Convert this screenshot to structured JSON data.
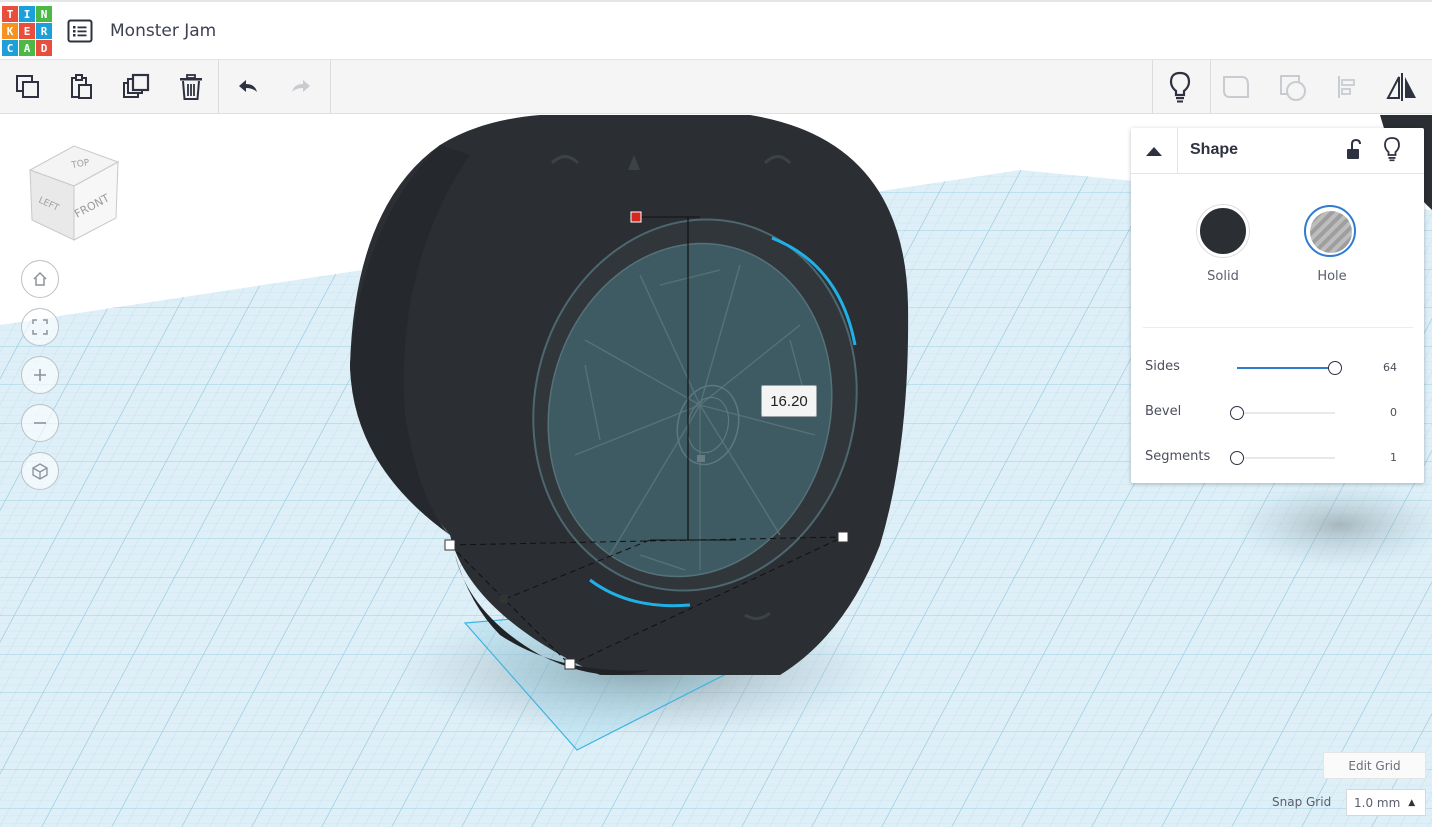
{
  "app": {
    "logo_letters": [
      [
        "T",
        "I",
        "N"
      ],
      [
        "K",
        "E",
        "R"
      ],
      [
        "C",
        "A",
        "D"
      ]
    ],
    "logo_colors": [
      "#e94e3d",
      "#1d9fd9",
      "#4cb848",
      "#f7921e"
    ],
    "document_title": "Monster Jam"
  },
  "toolbar": {
    "left_tools": [
      "copy-icon",
      "paste-icon",
      "duplicate-icon",
      "delete-icon",
      "undo-icon",
      "redo-icon"
    ],
    "right_tools": [
      "lightbulb-icon",
      "group-icon",
      "ungroup-icon",
      "align-icon",
      "mirror-icon"
    ]
  },
  "viewcube": {
    "faces": {
      "top": "TOP",
      "left": "LEFT",
      "front": "FRONT"
    }
  },
  "dimension": {
    "value": "16.20"
  },
  "inspector": {
    "title": "Shape",
    "solid_label": "Solid",
    "hole_label": "Hole",
    "selected_mode": "Hole",
    "properties": [
      {
        "label": "Sides",
        "value": "64",
        "fraction": 1.0
      },
      {
        "label": "Bevel",
        "value": "0",
        "fraction": 0.0
      },
      {
        "label": "Segments",
        "value": "1",
        "fraction": 0.0
      }
    ]
  },
  "grid": {
    "edit_grid_label": "Edit Grid",
    "snap_grid_label": "Snap Grid",
    "snap_grid_value": "1.0 mm"
  },
  "colors": {
    "grid_background": "#d7ecf5",
    "grid_line": "#a9d3e6",
    "tire": "#2b2f33",
    "hole_fill": "#3e5a62",
    "selection_blue": "#1fb1e6",
    "handle_red": "#d7261e",
    "accent": "#2e7bcf"
  }
}
